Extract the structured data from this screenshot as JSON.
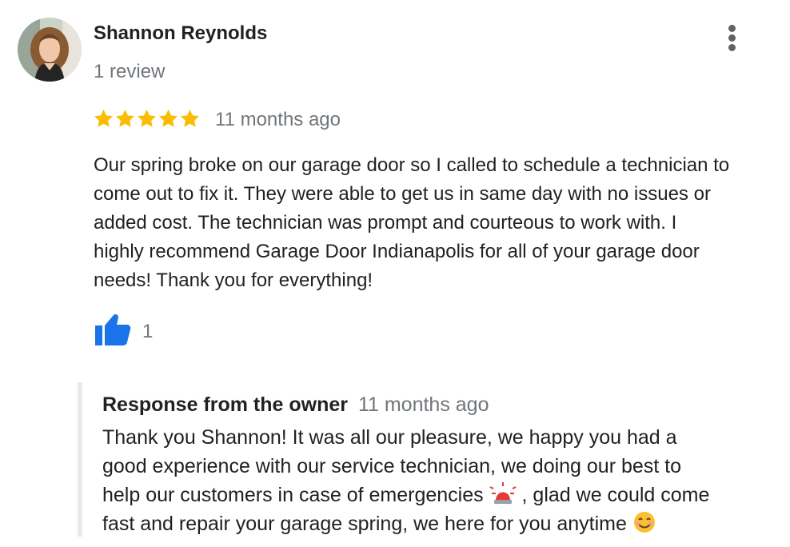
{
  "reviewer": {
    "name": "Shannon Reynolds",
    "review_count": "1 review"
  },
  "review": {
    "rating": 5,
    "max_rating": 5,
    "date": "11 months ago",
    "text": "Our spring broke on our garage door so I called to schedule a technician to\ncome out to fix it. They were able to get us in same day with no issues or\nadded cost. The technician was prompt and courteous to work with. I\nhighly recommend Garage Door Indianapolis for all of your garage door\nneeds! Thank you for everything!",
    "like_count": "1"
  },
  "owner_response": {
    "title": "Response from the owner",
    "date": "11 months ago",
    "line_1": "Thank you Shannon! It was all our pleasure, we happy you had a",
    "line_2": "good experience with our service technician, we doing our best to",
    "line_3_start": "help our customers in case of emergencies",
    "line_3_end": ", glad we could come",
    "line_4": "fast and repair your garage spring, we here for you anytime"
  },
  "icons": {
    "star": "star-icon",
    "like": "thumbs-up-icon",
    "more": "more-vertical-icon",
    "emergency": "police-car-light-emoji",
    "smile": "smiling-face-emoji"
  },
  "colors": {
    "star": "#fbbc04",
    "like": "#1a73e8",
    "secondary_text": "#70757a",
    "response_bar": "#e8eaed"
  }
}
